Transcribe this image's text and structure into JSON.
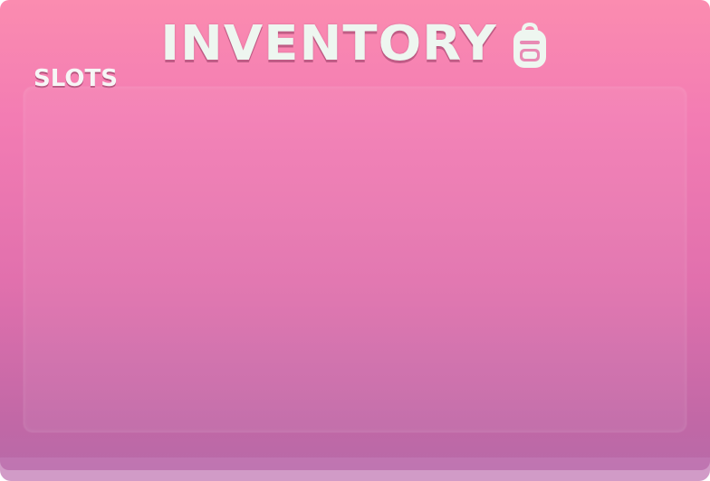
{
  "inventory": {
    "title": "INVENTORY",
    "title_icon": "backpack-icon",
    "section_label": "SLOTS",
    "slots": []
  },
  "colors": {
    "panel_top": "#fb8cb0",
    "panel_bottom": "#b86aa8",
    "title_text": "#eef6f0"
  }
}
